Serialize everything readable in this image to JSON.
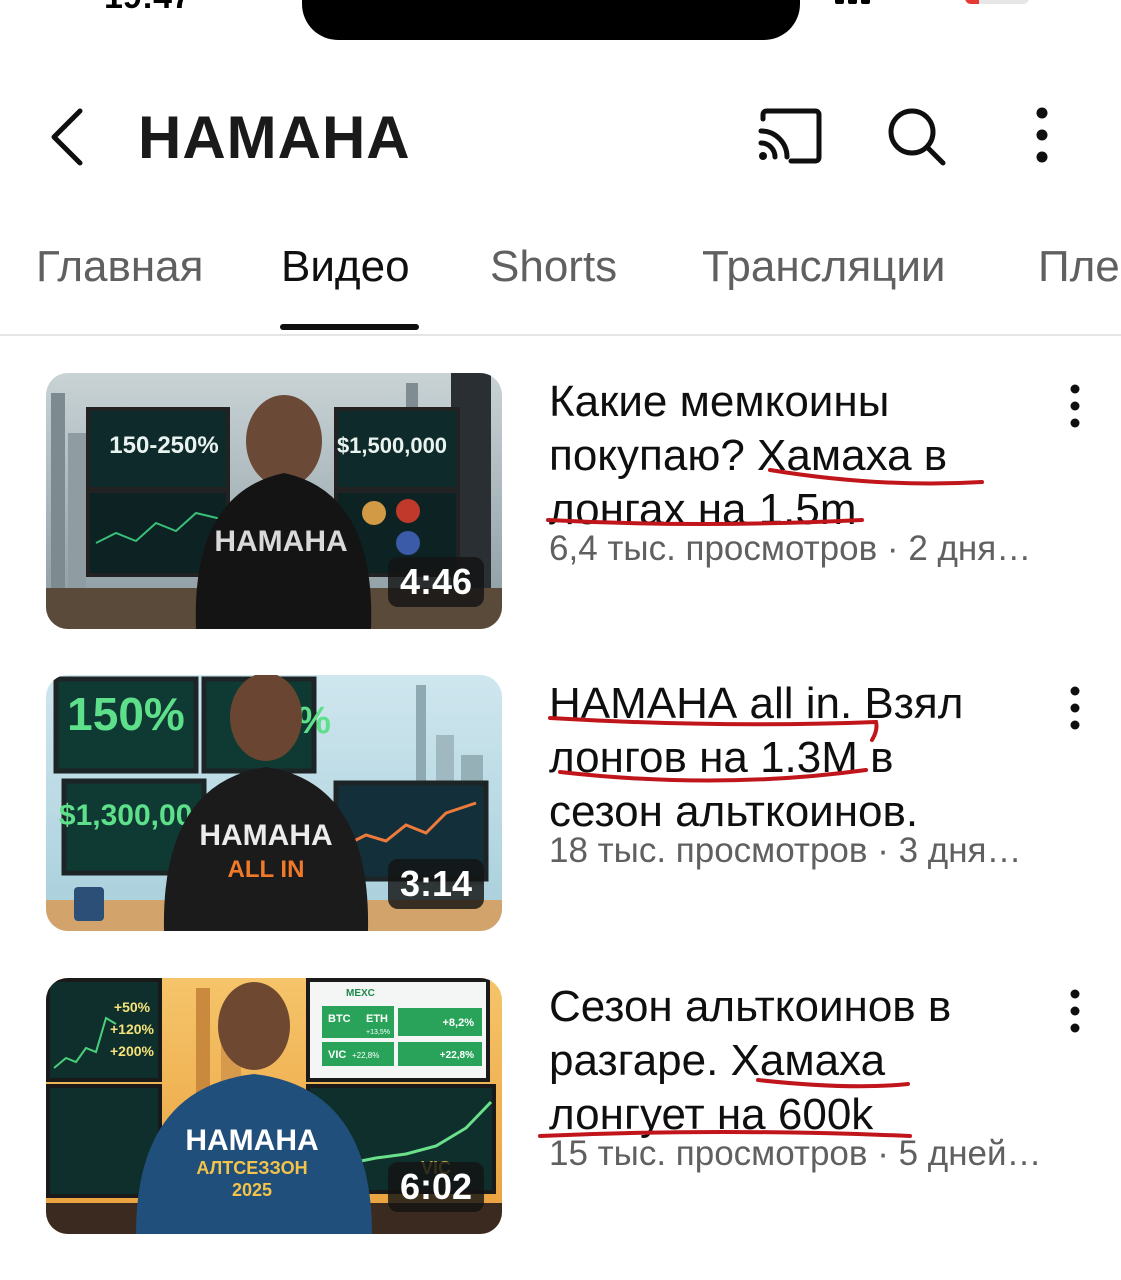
{
  "status_bar": {
    "time": "19:47"
  },
  "header": {
    "channel_title": "НАМАНА"
  },
  "tabs": [
    {
      "label": "Главная"
    },
    {
      "label": "Видео"
    },
    {
      "label": "Shorts"
    },
    {
      "label": "Трансляции"
    },
    {
      "label": "Пле"
    }
  ],
  "active_tab": "Видео",
  "videos": [
    {
      "title": "Какие мемкоины покупаю? Хамаха в лонгах на 1.5m",
      "meta": "6,4 тыс. просмотров · 2 дня…",
      "duration": "4:46",
      "thumb_texts": [
        "150-250%",
        "$1,500,000",
        "HAMAHA"
      ]
    },
    {
      "title": "НАМАНА all in. Взял лонгов на 1.3M в сезон альткоинов.",
      "meta": "18 тыс. просмотров · 3 дня…",
      "duration": "3:14",
      "thumb_texts": [
        "150%",
        "%",
        "$1,300,000",
        "HAMAHA",
        "ALL IN"
      ]
    },
    {
      "title": "Сезон альткоинов в разгаре. Хамаха лонгует на 600k",
      "meta": "15 тыс. просмотров · 5 дней…",
      "duration": "6:02",
      "thumb_texts": [
        "+50%",
        "+120%",
        "+200%",
        "MEXC",
        "BTC",
        "ETH",
        "+13,5%",
        "+8,2%",
        "VIC",
        "+22,8%",
        "+22,8%",
        "HAMAHA",
        "АЛТСЕЗЗОН",
        "2025",
        "VIC"
      ]
    }
  ],
  "colors": {
    "annotation_ink": "#c0161b",
    "text_primary": "#0f0f0f",
    "text_secondary": "#606060"
  }
}
